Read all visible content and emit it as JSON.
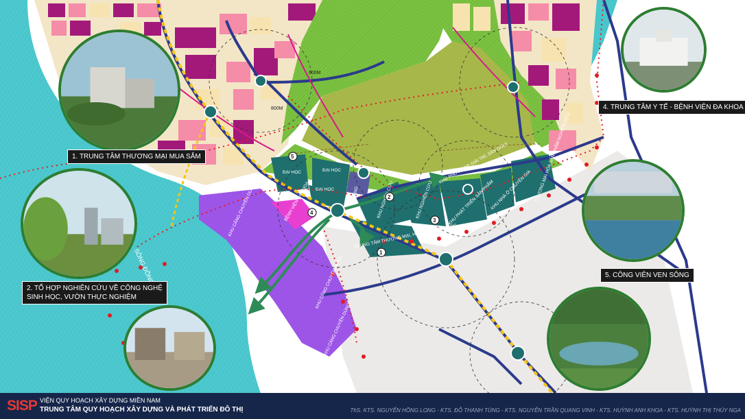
{
  "callouts": {
    "c1": "1. TRUNG TÂM THƯƠNG MẠI MUA SẮM",
    "c2_line1": "2. TỔ HỢP NGHIÊN CỨU VỀ CÔNG NGHỆ",
    "c2_line2": "SINH HỌC, VƯỜN THỰC NGHIỆM",
    "c4": "4. TRUNG TÂM Y TẾ - BỆNH VIỆN ĐA KHOA",
    "c5": "5. CÔNG VIÊN VEN SÔNG"
  },
  "map": {
    "dist_600": "600M",
    "dist_800": "800M",
    "river": "SÔNG ĐỒNG NAI",
    "zones": {
      "dai_hoc_1": "ĐẠI HỌC",
      "dai_hoc_2": "ĐẠI HỌC",
      "dai_hoc_3": "ĐẠI HỌC",
      "khu_nghien_cuu_1": "KHU NGHIÊN CỨU",
      "khu_nghien_cuu_2": "KHU NGHIÊN CỨU",
      "khu_phat_trien": "KHU PHÁT TRIỂN SẢN PHẨM",
      "khu_nha_o": "KHU NHÀ Ở CHUYÊN GIA",
      "thuong_mai_hoa": "THƯƠNG MẠI HÓA SẢN PHẨM NGHIÊN CỨU",
      "khu_phuc_hop": "KHU PHỨC HỢP GIẢI TRÍ, SÂN GOLF",
      "trung_tam_tm": "TRUNG TÂM THƯƠNG MẠI, HỘI NGHỊ KHOA HỌC",
      "benh_vien": "BỆNH VIỆN ĐA KHOA",
      "khu_cang_1": "KHU CẢNG CHUYÊN DÙNG",
      "khu_cang_2": "KHU CẢNG CHUYÊN DÙNG",
      "khu_cang_3": "KHU CẢNG CHUYÊN DÙNG",
      "cang": "CẢNG"
    },
    "markers": [
      "1",
      "2",
      "3",
      "4",
      "5"
    ]
  },
  "footer": {
    "logo": "SISP",
    "org1": "VIỆN QUY HOẠCH XÂY DỰNG MIỀN NAM",
    "org2": "TRUNG TÂM QUY HOẠCH XÂY DỰNG VÀ PHÁT TRIỂN ĐÔ THỊ",
    "authors": "ThS. KTS. NGUYỄN HỒNG LONG - KTS. ĐỖ THANH TÙNG - KTS. NGUYỄN TRẦN QUANG VINH - KTS. HUỲNH ANH KHOA - KTS. HUỲNH THỊ THÚY NGA"
  },
  "colors": {
    "river": "#49c6cc",
    "park": "#7cc242",
    "golf": "#a7b74a",
    "teal_zone": "#1f6f6f",
    "purple_zone": "#9b52e6",
    "magenta": "#a3197a",
    "pink": "#f58ca8",
    "beige": "#f7e3b0",
    "road": "#2b3a8c",
    "axis_yellow": "#f5c518",
    "footer": "#16264a",
    "logo": "#e53935"
  }
}
